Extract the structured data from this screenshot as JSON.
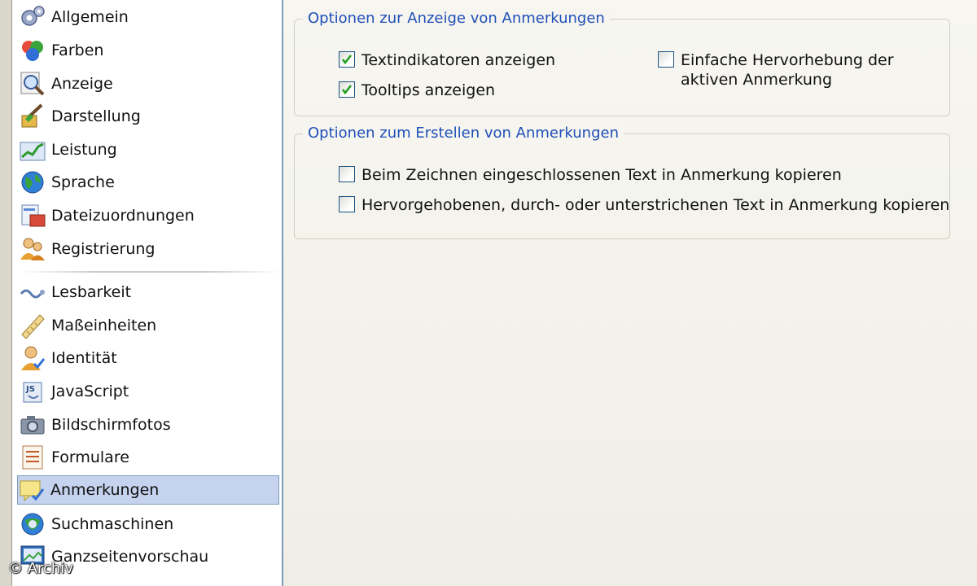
{
  "sidebar": {
    "top_items": [
      {
        "label": "Allgemein",
        "icon": "gears-icon"
      },
      {
        "label": "Farben",
        "icon": "color-balls-icon"
      },
      {
        "label": "Anzeige",
        "icon": "magnifier-icon"
      },
      {
        "label": "Darstellung",
        "icon": "paint-brush-icon"
      },
      {
        "label": "Leistung",
        "icon": "chart-icon"
      },
      {
        "label": "Sprache",
        "icon": "globe-icon"
      },
      {
        "label": "Dateizuordnungen",
        "icon": "file-association-icon"
      },
      {
        "label": "Registrierung",
        "icon": "users-icon"
      }
    ],
    "bottom_items": [
      {
        "label": "Lesbarkeit",
        "icon": "readability-icon"
      },
      {
        "label": "Maßeinheiten",
        "icon": "ruler-icon"
      },
      {
        "label": "Identität",
        "icon": "identity-icon"
      },
      {
        "label": "JavaScript",
        "icon": "javascript-icon"
      },
      {
        "label": "Bildschirmfotos",
        "icon": "camera-icon"
      },
      {
        "label": "Formulare",
        "icon": "form-icon"
      },
      {
        "label": "Anmerkungen",
        "icon": "notes-icon",
        "selected": true
      },
      {
        "label": "Suchmaschinen",
        "icon": "search-engine-icon"
      },
      {
        "label": "Ganzseitenvorschau",
        "icon": "page-preview-icon"
      }
    ]
  },
  "groups": {
    "display": {
      "title": "Optionen zur Anzeige von Anmerkungen",
      "options": [
        {
          "label": "Textindikatoren anzeigen",
          "checked": true
        },
        {
          "label": "Tooltips anzeigen",
          "checked": true
        },
        {
          "label": "Einfache Hervorhebung der aktiven Anmerkung",
          "checked": false
        }
      ]
    },
    "create": {
      "title": "Optionen zum Erstellen von Anmerkungen",
      "options": [
        {
          "label": "Beim Zeichnen eingeschlossenen Text in Anmerkung kopieren",
          "checked": false
        },
        {
          "label": "Hervorgehobenen, durch- oder unterstrichenen Text in Anmerkung kopieren",
          "checked": false
        }
      ]
    }
  },
  "watermark": "© Archiv",
  "colors": {
    "group_title": "#1f4fb8",
    "selection_bg": "#c5d3ee",
    "checkbox_border": "#1c5180",
    "check_mark": "#21a121"
  }
}
